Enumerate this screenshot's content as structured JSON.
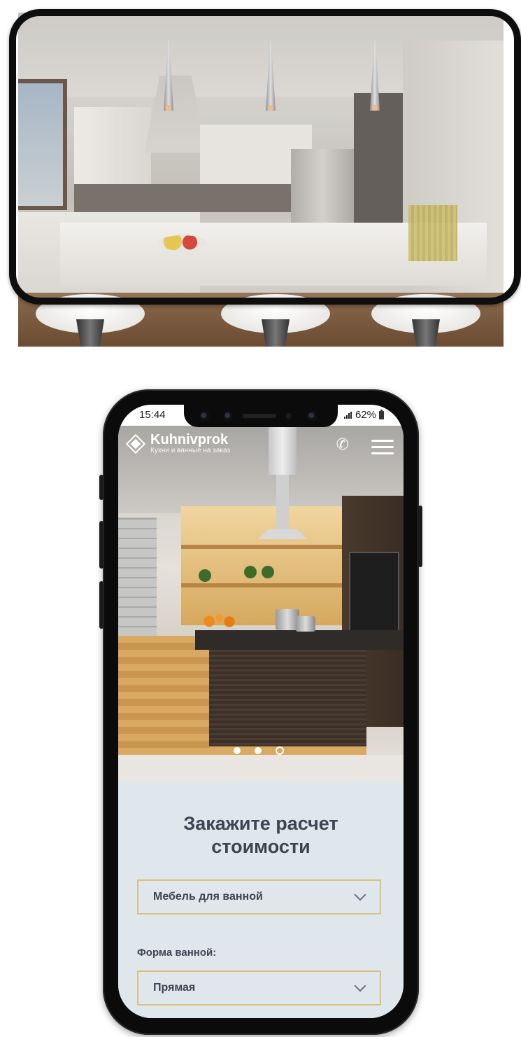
{
  "status_bar": {
    "time": "15:44",
    "battery": "62%"
  },
  "brand": {
    "name": "Kuhnivprok",
    "tagline": "Кухни и ванные на заказ"
  },
  "form": {
    "title_line1": "Закажите расчет",
    "title_line2": "стоимости",
    "category_select": {
      "value": "Мебель для ванной"
    },
    "shape_label": "Форма ванной:",
    "shape_select": {
      "value": "Прямая"
    }
  },
  "carousel": {
    "slides": 3,
    "active_index": 2
  },
  "colors": {
    "accent_border": "#d8c27a",
    "form_bg": "#dfe6ec",
    "text_dark": "#3e4552"
  },
  "icons": [
    "logo-icon",
    "phone-icon",
    "menu-icon",
    "chevron-down-icon",
    "signal-icon",
    "battery-icon"
  ]
}
